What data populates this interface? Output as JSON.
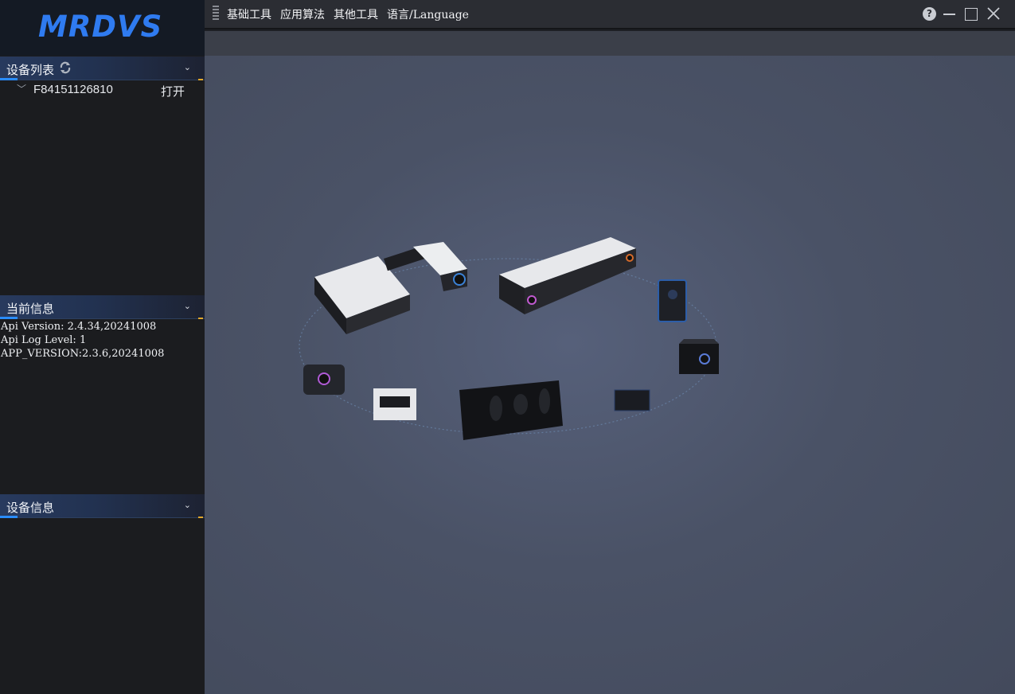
{
  "app": {
    "logo_text": "MRDVS",
    "brand_color": "#2f7bf0"
  },
  "menu": {
    "items": [
      "基础工具",
      "应用算法",
      "其他工具",
      "语言/Language"
    ]
  },
  "device_list": {
    "title": "设备列表",
    "devices": [
      {
        "serial": "F84151126810",
        "action": "打开"
      }
    ]
  },
  "current_info": {
    "title": "当前信息",
    "lines": [
      "Api Version: 2.4.34,20241008",
      "Api Log Level: 1",
      "APP_VERSION:2.3.6,20241008"
    ]
  },
  "device_info": {
    "title": "设备信息"
  },
  "colors": {
    "accent": "#2a8cff",
    "panel": "#1b1c1f",
    "canvas": "#4a5266"
  }
}
